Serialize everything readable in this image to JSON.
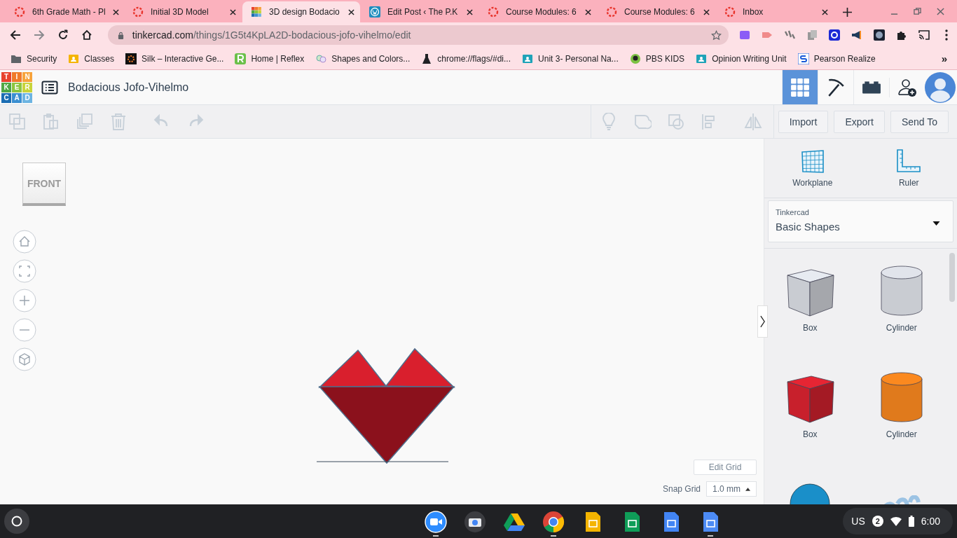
{
  "browser": {
    "tabs": [
      {
        "title": "6th Grade Math - Pl",
        "kind": "ring",
        "selected": false
      },
      {
        "title": "Initial 3D Model",
        "kind": "ring",
        "selected": false
      },
      {
        "title": "3D design Bodacio",
        "kind": "tinkercad",
        "selected": true
      },
      {
        "title": "Edit Post ‹ The P.K",
        "kind": "wordpress",
        "selected": false
      },
      {
        "title": "Course Modules: 6",
        "kind": "ring",
        "selected": false
      },
      {
        "title": "Course Modules: 6",
        "kind": "ring",
        "selected": false
      },
      {
        "title": "Inbox",
        "kind": "ring",
        "selected": false
      }
    ],
    "address": {
      "host": "tinkercad.com",
      "path": "/things/1G5t4KpLA2D-bodacious-jofo-vihelmo/edit"
    },
    "bookmarks": [
      {
        "label": "Security",
        "kind": "folder"
      },
      {
        "label": "Classes",
        "kind": "classroom"
      },
      {
        "label": "Silk – Interactive Ge...",
        "kind": "silk"
      },
      {
        "label": "Home | Reflex",
        "kind": "reflex"
      },
      {
        "label": "Shapes and Colors...",
        "kind": "abc"
      },
      {
        "label": "chrome://flags/#di...",
        "kind": "flask"
      },
      {
        "label": "Unit 3- Personal Na...",
        "kind": "classroom"
      },
      {
        "label": "PBS KIDS",
        "kind": "pbs"
      },
      {
        "label": "Opinion Writing Unit",
        "kind": "classroom"
      },
      {
        "label": "Pearson Realize",
        "kind": "pearson"
      }
    ],
    "bookmarks_more": "»"
  },
  "app": {
    "logo_letters": [
      {
        "letter": "T",
        "color": "#e8432e"
      },
      {
        "letter": "I",
        "color": "#f07a2b"
      },
      {
        "letter": "N",
        "color": "#f7a33b"
      },
      {
        "letter": "K",
        "color": "#4fa845"
      },
      {
        "letter": "E",
        "color": "#8cc63f"
      },
      {
        "letter": "R",
        "color": "#c8d43a"
      },
      {
        "letter": "C",
        "color": "#1b6db3"
      },
      {
        "letter": "A",
        "color": "#3b8fd1"
      },
      {
        "letter": "D",
        "color": "#6cb4e2"
      }
    ],
    "title": "Bodacious Jofo-Vihelmo",
    "nav": [
      {
        "kind": "grid",
        "selected": true
      },
      {
        "kind": "pickaxe",
        "selected": false
      },
      {
        "kind": "bricks",
        "selected": false
      }
    ],
    "tools": [
      {
        "kind": "copy",
        "disabled": true
      },
      {
        "kind": "paste",
        "disabled": true
      },
      {
        "kind": "duplicate",
        "disabled": true
      },
      {
        "kind": "delete",
        "disabled": true
      },
      {
        "kind": "undo",
        "disabled": true
      },
      {
        "kind": "redo",
        "disabled": true
      }
    ],
    "shape_tools": [
      {
        "kind": "bulb",
        "disabled": true
      },
      {
        "kind": "solid",
        "disabled": true
      },
      {
        "kind": "hole",
        "disabled": true
      },
      {
        "kind": "align",
        "disabled": true
      },
      {
        "kind": "mirror",
        "disabled": true
      }
    ],
    "actions": [
      "Import",
      "Export",
      "Send To"
    ]
  },
  "canvas": {
    "view_cube": "FRONT",
    "edit_grid": "Edit Grid",
    "snap_label": "Snap Grid",
    "snap_value": "1.0 mm"
  },
  "panel": {
    "tools": [
      {
        "label": "Workplane",
        "kind": "workplane"
      },
      {
        "label": "Ruler",
        "kind": "ruler"
      }
    ],
    "library": {
      "source": "Tinkercad",
      "category": "Basic Shapes"
    },
    "shapes": [
      {
        "label": "Box",
        "kind": "box",
        "color": "#c9ccd2"
      },
      {
        "label": "Cylinder",
        "kind": "cylinder",
        "color": "#c9ccd2"
      },
      {
        "label": "Box",
        "kind": "box",
        "color": "#c8202c"
      },
      {
        "label": "Cylinder",
        "kind": "cylinder",
        "color": "#e07a1c"
      },
      {
        "kind": "sphere",
        "color": "#1a8fc9"
      },
      {
        "kind": "text",
        "color": "#9cc3e4"
      }
    ]
  },
  "shelf": {
    "apps": [
      {
        "kind": "video",
        "open": true
      },
      {
        "kind": "camera",
        "open": false
      },
      {
        "kind": "drive",
        "open": false
      },
      {
        "kind": "chrome",
        "open": true
      },
      {
        "kind": "slides",
        "open": false
      },
      {
        "kind": "sheets",
        "open": false
      },
      {
        "kind": "docs",
        "open": false
      },
      {
        "kind": "files",
        "open": true
      }
    ],
    "status": {
      "ime": "US",
      "notifications": "2",
      "time": "6:00"
    }
  }
}
